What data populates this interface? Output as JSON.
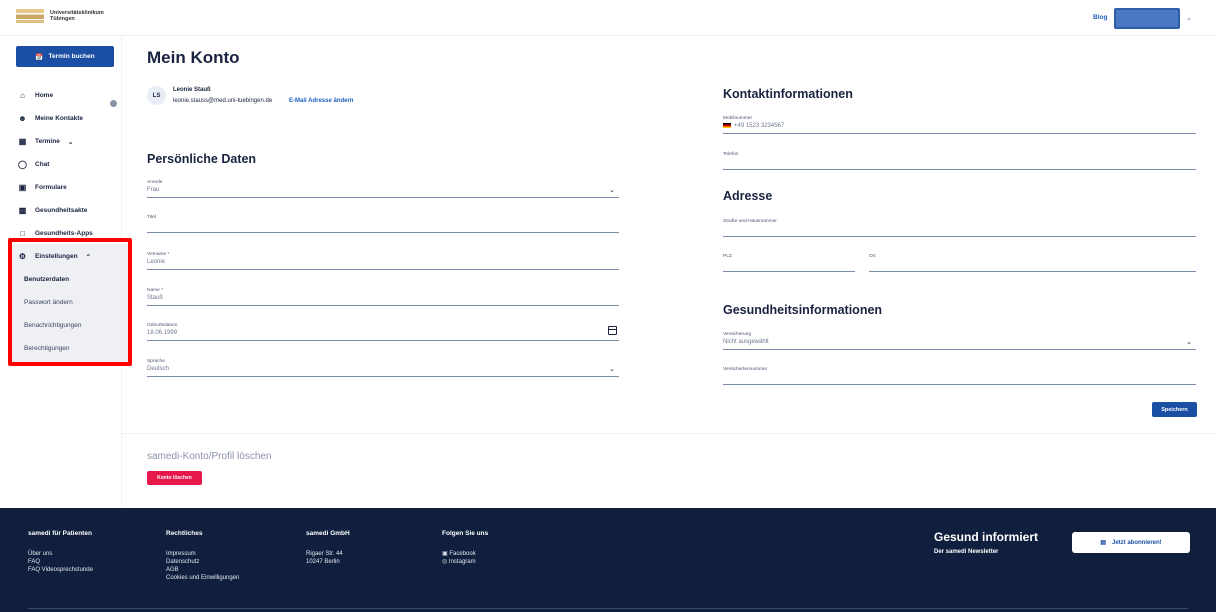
{
  "header": {
    "logo_line1": "Universitätsklinikum",
    "logo_line2": "Tübingen",
    "blog": "Blog"
  },
  "sidebar": {
    "book_button": "Termin buchen",
    "items": [
      {
        "label": "Home",
        "icon": "home-icon"
      },
      {
        "label": "Meine Kontakte",
        "icon": "contacts-icon"
      },
      {
        "label": "Termine",
        "icon": "calendar-icon"
      },
      {
        "label": "Chat",
        "icon": "chat-icon"
      },
      {
        "label": "Formulare",
        "icon": "clipboard-icon"
      },
      {
        "label": "Gesundheitsakte",
        "icon": "record-icon"
      },
      {
        "label": "Gesundheits-Apps",
        "icon": "apps-icon"
      },
      {
        "label": "Einstellungen",
        "icon": "settings-user-icon"
      }
    ],
    "submenu": [
      "Benutzerdaten",
      "Passwort ändern",
      "Benachrichtigungen",
      "Berechtigungen"
    ]
  },
  "main": {
    "title": "Mein Konto",
    "user": {
      "initials": "LS",
      "name": "Leonie Stauß",
      "email": "leonie.stauss@med.uni-tuebingen.de",
      "change_email": "E-Mail Adresse ändern"
    },
    "personal": {
      "title": "Persönliche Daten",
      "anrede_label": "Anrede",
      "anrede_value": "Frau",
      "titel_label": "Titel",
      "vorname_label": "Vorname *",
      "vorname_value": "Leonie",
      "name_label": "Name *",
      "name_value": "Stauß",
      "geburt_label": "Geburtsdatum",
      "geburt_value": "18.06.1999",
      "sprache_label": "Sprache",
      "sprache_value": "Deutsch"
    },
    "contact": {
      "title": "Kontaktinformationen",
      "mobile_label": "Mobilnummer",
      "mobile_value": "+49 1523 3234567",
      "phone_label": "Telefon"
    },
    "address": {
      "title": "Adresse",
      "street_label": "Straße und Hausnummer",
      "plz_label": "PLZ",
      "ort_label": "Ort"
    },
    "health": {
      "title": "Gesundheitsinformationen",
      "insurance_label": "Versicherung",
      "insurance_value": "Nicht ausgewählt",
      "insured_number_label": "Versichertennummer"
    },
    "save_button": "Speichern",
    "delete": {
      "title": "samedi-Konto/Profil löschen",
      "button": "Konto löschen"
    }
  },
  "footer": {
    "cols": [
      {
        "title": "samedi für Patienten",
        "links": [
          "Über uns",
          "FAQ",
          "FAQ Videosprechstunde"
        ]
      },
      {
        "title": "Rechtliches",
        "links": [
          "Impressum",
          "Datenschutz",
          "AGB",
          "Cookies und Einwilligungen"
        ]
      },
      {
        "title": "samedi GmbH",
        "links": [
          "Rigaer Str. 44",
          "10247 Berlin"
        ]
      },
      {
        "title": "Folgen Sie uns",
        "links": [
          "Facebook",
          "Instagram"
        ]
      }
    ],
    "newsletter_title": "Gesund informiert",
    "newsletter_sub": "Der samedi Newsletter",
    "subscribe_button": "Jetzt abonnieren!"
  },
  "colors": {
    "primary": "#1b4fa3",
    "danger": "#e6184c",
    "footer": "#0f1f3d",
    "highlight": "#ff0000"
  }
}
